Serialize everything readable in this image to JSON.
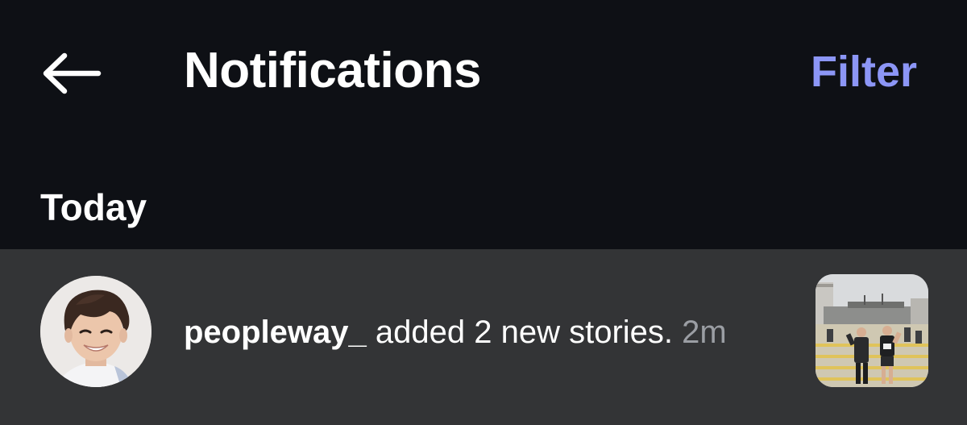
{
  "header": {
    "back_icon": "arrow-left-icon",
    "title": "Notifications",
    "filter_label": "Filter"
  },
  "section": {
    "label": "Today"
  },
  "notifications": [
    {
      "username": "peopleway_",
      "message": "added 2 new stories.",
      "time": "2m",
      "avatar": "user-avatar",
      "thumbnail": "story-thumbnail"
    }
  ],
  "colors": {
    "background": "#0e1015",
    "row_background": "#333436",
    "accent": "#8c96f6",
    "text_primary": "#ffffff",
    "text_secondary": "#9b9ea4"
  }
}
